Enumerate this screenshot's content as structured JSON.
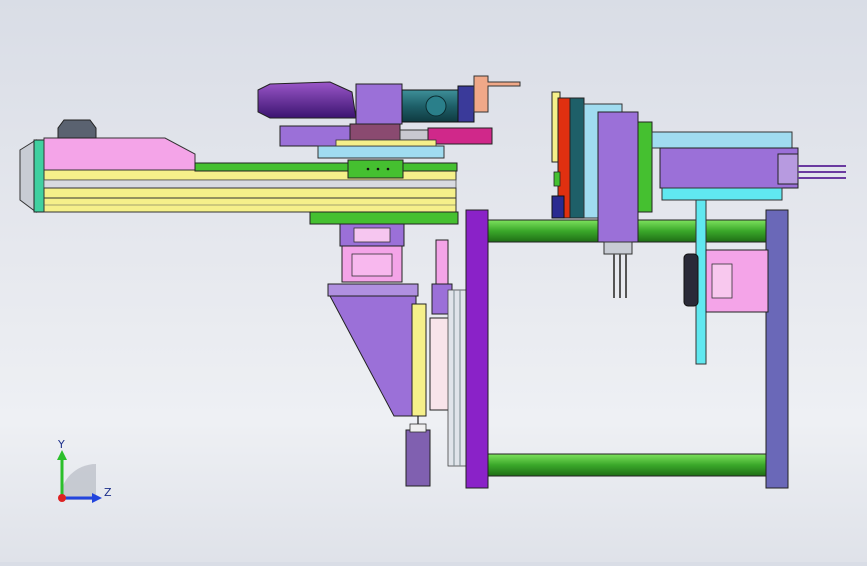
{
  "viewport": {
    "background_top": "#d9dde6",
    "background_bottom": "#eef0f4"
  },
  "triad": {
    "y_label": "Y",
    "z_label": "Z",
    "y_color": "#2bbf2b",
    "z_color": "#2244dd",
    "x_color": "#dd2222"
  },
  "colors": {
    "pink": "#f4a4e8",
    "light_pink": "#f6c6f0",
    "yellow": "#f5f08a",
    "green": "#45c030",
    "dark_green": "#2f8f1e",
    "purple": "#9b70d8",
    "violet": "#8a22c8",
    "slate_blue": "#6a68b8",
    "cyan": "#60e8f0",
    "teal": "#1e6b72",
    "salmon": "#f0a888",
    "magenta": "#d0288a",
    "navy": "#2a2a90",
    "red": "#e03010"
  }
}
